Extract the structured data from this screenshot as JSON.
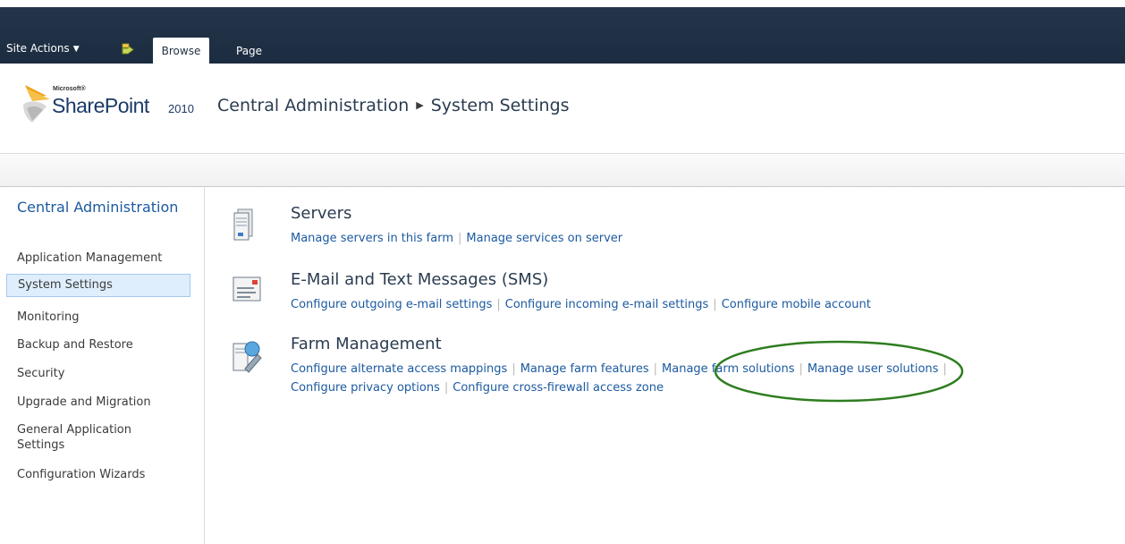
{
  "ribbon": {
    "site_actions": "Site Actions",
    "tabs": [
      {
        "label": "Browse"
      },
      {
        "label": "Page"
      }
    ]
  },
  "logo": {
    "microsoft": "Microsoft®",
    "product": "SharePoint",
    "version": "2010"
  },
  "breadcrumb": {
    "root": "Central Administration",
    "current": "System Settings"
  },
  "leftnav": {
    "heading": "Central Administration",
    "items": [
      {
        "label": "Application Management"
      },
      {
        "label": "System Settings"
      },
      {
        "label": "Monitoring"
      },
      {
        "label": "Backup and Restore"
      },
      {
        "label": "Security"
      },
      {
        "label": "Upgrade and Migration"
      },
      {
        "label": "General Application Settings"
      },
      {
        "label": "Configuration Wizards"
      }
    ]
  },
  "sections": [
    {
      "title": "Servers",
      "icon": "server-icon",
      "lines": [
        [
          "Manage servers in this farm",
          "Manage services on server"
        ]
      ]
    },
    {
      "title": "E-Mail and Text Messages (SMS)",
      "icon": "email-icon",
      "lines": [
        [
          "Configure outgoing e-mail settings",
          "Configure incoming e-mail settings",
          "Configure mobile account"
        ]
      ]
    },
    {
      "title": "Farm Management",
      "icon": "farm-management-icon",
      "lines": [
        [
          "Configure alternate access mappings",
          "Manage farm features",
          "Manage farm solutions",
          "Manage user solutions",
          ""
        ],
        [
          "Configure privacy options",
          "Configure cross-firewall access zone"
        ]
      ]
    }
  ],
  "highlight_color": "#2e7d1f"
}
